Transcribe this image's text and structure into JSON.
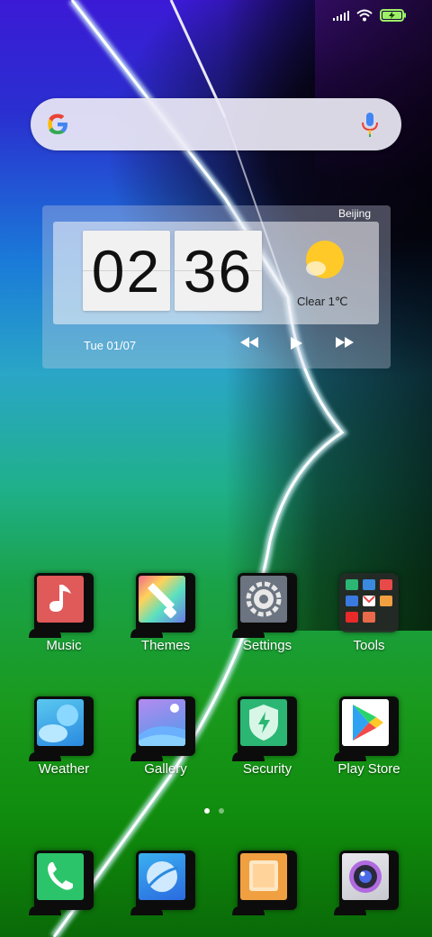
{
  "status_bar": {
    "icons": [
      "signal-icon",
      "wifi-icon",
      "battery-charging-icon"
    ],
    "battery_color": "#9bf067"
  },
  "search": {
    "icons": [
      "google-logo",
      "mic-icon"
    ]
  },
  "clock_widget": {
    "city": "Beijing",
    "hour": "02",
    "minute": "36",
    "weather": "Clear  1℃",
    "date": "Tue 01/07",
    "controls": [
      "previous-icon",
      "play-icon",
      "next-icon"
    ]
  },
  "apps_row1": [
    {
      "label": "Music",
      "color": "#e05a5a"
    },
    {
      "label": "Themes",
      "color": "#7a6ae0"
    },
    {
      "label": "Settings",
      "color": "#6b7480"
    },
    {
      "label": "Tools",
      "color": "#3a3a3a"
    }
  ],
  "apps_row2": [
    {
      "label": "Weather",
      "color": "#3aa7e8"
    },
    {
      "label": "Gallery",
      "color": "#5a8ae8"
    },
    {
      "label": "Security",
      "color": "#2bb673"
    },
    {
      "label": "Play Store",
      "color": "#ffffff"
    }
  ],
  "dock": [
    {
      "name": "phone",
      "color": "#2bc46a"
    },
    {
      "name": "browser",
      "color": "#2a8ae0"
    },
    {
      "name": "notes",
      "color": "#f0a040"
    },
    {
      "name": "camera",
      "color": "#8a4ad0"
    }
  ],
  "page_indicator": {
    "pages": 2,
    "active": 1
  }
}
